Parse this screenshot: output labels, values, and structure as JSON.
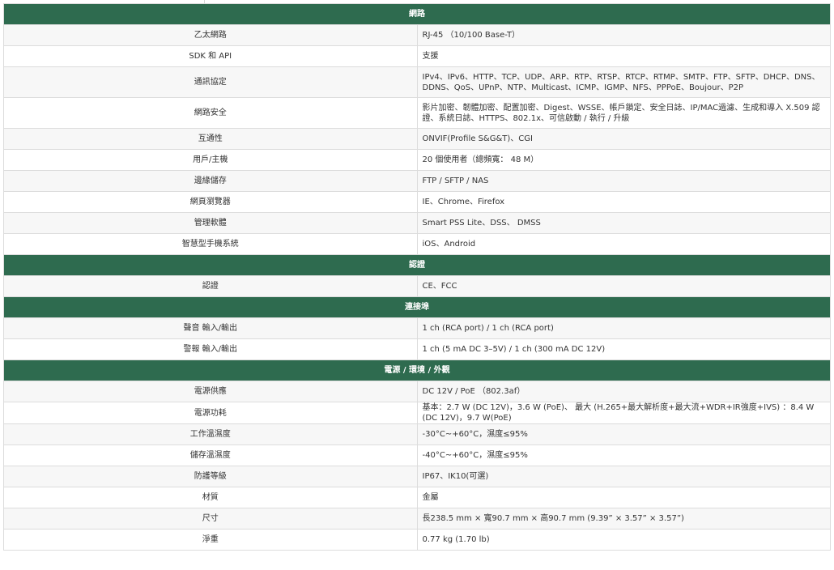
{
  "sections": [
    {
      "title": "網路",
      "rows": [
        {
          "label": "乙太網路",
          "value": "RJ-45 （10/100 Base-T）"
        },
        {
          "label": "SDK 和 API",
          "value": "支援"
        },
        {
          "label": "通訊協定",
          "value": "IPv4、IPv6、HTTP、TCP、UDP、ARP、RTP、RTSP、RTCP、RTMP、SMTP、FTP、SFTP、DHCP、DNS、DDNS、QoS、UPnP、NTP、Multicast、ICMP、IGMP、NFS、PPPoE、Boujour、P2P"
        },
        {
          "label": "網路安全",
          "value": "影片加密、韌體加密、配置加密、Digest、WSSE、帳戶鎖定、安全日誌、IP/MAC過濾、生成和導入 X.509 認證、系統日誌、HTTPS、802.1x、可信啟動 / 執行 / 升級"
        },
        {
          "label": "互通性",
          "value": "ONVIF(Profile S&G&T)、CGI"
        },
        {
          "label": "用戶/主機",
          "value": "20 個使用者（總頻寬： 48 M）"
        },
        {
          "label": "邊緣儲存",
          "value": "FTP / SFTP / NAS"
        },
        {
          "label": "網頁瀏覽器",
          "value": "IE、Chrome、Firefox"
        },
        {
          "label": "管理軟體",
          "value": "Smart PSS Lite、DSS、 DMSS"
        },
        {
          "label": "智慧型手機系統",
          "value": "iOS、Android"
        }
      ]
    },
    {
      "title": "認證",
      "rows": [
        {
          "label": "認證",
          "value": "CE、FCC"
        }
      ]
    },
    {
      "title": "連接埠",
      "rows": [
        {
          "label": "聲音 輸入/輸出",
          "value": "1 ch (RCA port) / 1 ch (RCA port)"
        },
        {
          "label": "警報 輸入/輸出",
          "value": "1 ch (5 mA DC 3–5V) / 1 ch (300 mA DC 12V)"
        }
      ]
    },
    {
      "title": "電源 / 環境 / 外觀",
      "rows": [
        {
          "label": "電源供應",
          "value": "DC 12V / PoE （802.3af）"
        },
        {
          "label": "電源功耗",
          "value": "基本：2.7 W (DC 12V)，3.6 W (PoE)、 最大 (H.265+最大解析度+最大流+WDR+IR強度+IVS) ：8.4 W (DC 12V)，9.7 W(PoE)"
        },
        {
          "label": "工作溫濕度",
          "value": "-30°C~+60°C，濕度≤95%"
        },
        {
          "label": "儲存溫濕度",
          "value": "-40°C~+60°C，濕度≤95%"
        },
        {
          "label": "防護等級",
          "value": "IP67、IK10(可選)"
        },
        {
          "label": "材質",
          "value": "金屬"
        },
        {
          "label": "尺寸",
          "value": "長238.5 mm × 寬90.7 mm × 高90.7 mm (9.39” × 3.57” × 3.57”)"
        },
        {
          "label": "淨重",
          "value": "0.77 kg (1.70 lb)"
        }
      ]
    }
  ]
}
